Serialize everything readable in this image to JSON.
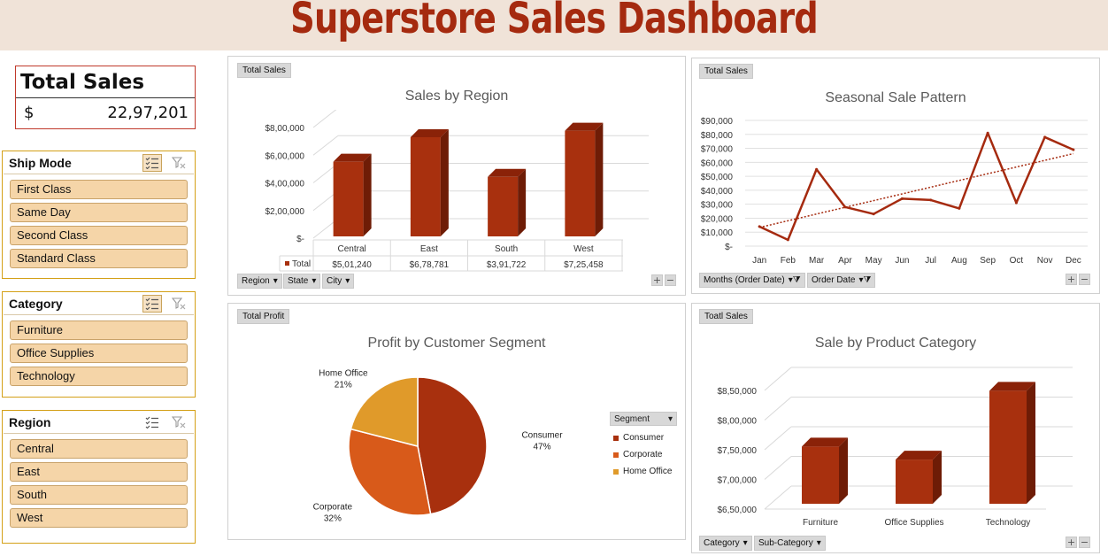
{
  "dashboard": {
    "title": "Superstore Sales Dashboard"
  },
  "kpi": {
    "title": "Total Sales",
    "currency": "$",
    "value": "22,97,201"
  },
  "slicers": {
    "ship_mode": {
      "label": "Ship Mode",
      "items": [
        "First Class",
        "Same Day",
        "Second Class",
        "Standard Class"
      ]
    },
    "category": {
      "label": "Category",
      "items": [
        "Furniture",
        "Office Supplies",
        "Technology"
      ]
    },
    "region": {
      "label": "Region",
      "items": [
        "Central",
        "East",
        "South",
        "West"
      ]
    }
  },
  "panels": {
    "region": {
      "tag": "Total Sales",
      "title": "Sales by Region",
      "fields": [
        "Region",
        "State",
        "City"
      ],
      "row_label": "Total"
    },
    "seasonal": {
      "tag": "Total Sales",
      "title": "Seasonal Sale Pattern",
      "fields": [
        "Months (Order Date)",
        "Order Date"
      ]
    },
    "profit": {
      "tag": "Total Profit",
      "title": "Profit by Customer Segment",
      "legend_title": "Segment"
    },
    "category": {
      "tag": "Toatl Sales",
      "title": "Sale by Product Category",
      "fields": [
        "Category",
        "Sub-Category"
      ]
    },
    "plus": "+",
    "minus": "−"
  },
  "colors": {
    "accent": "#a52a0f",
    "bar": "#a8300e",
    "bar_side": "#6e1c06",
    "bar_top": "#8a2208",
    "consumer": "#a8300e",
    "corporate": "#d85a1a",
    "home_office": "#e09a2a"
  },
  "chart_data": [
    {
      "type": "bar",
      "title": "Sales by Region",
      "categories": [
        "Central",
        "East",
        "South",
        "West"
      ],
      "values": [
        501240,
        678781,
        391722,
        725458
      ],
      "value_labels": [
        "$5,01,240",
        "$6,78,781",
        "$3,91,722",
        "$7,25,458"
      ],
      "y_ticks": [
        "$-",
        "$2,00,000",
        "$4,00,000",
        "$6,00,000",
        "$8,00,000"
      ],
      "ylim": [
        0,
        800000
      ]
    },
    {
      "type": "line",
      "title": "Seasonal Sale Pattern",
      "categories": [
        "Jan",
        "Feb",
        "Mar",
        "Apr",
        "May",
        "Jun",
        "Jul",
        "Aug",
        "Sep",
        "Oct",
        "Nov",
        "Dec"
      ],
      "values": [
        14000,
        4500,
        55000,
        28000,
        23000,
        34000,
        33000,
        27000,
        81000,
        31000,
        78000,
        69000
      ],
      "trendline": true,
      "y_ticks": [
        "$-",
        "$10,000",
        "$20,000",
        "$30,000",
        "$40,000",
        "$50,000",
        "$60,000",
        "$70,000",
        "$80,000",
        "$90,000"
      ],
      "ylim": [
        0,
        90000
      ]
    },
    {
      "type": "pie",
      "title": "Profit by Customer Segment",
      "labels": [
        "Consumer",
        "Corporate",
        "Home Office"
      ],
      "values": [
        47,
        32,
        21
      ],
      "value_labels": [
        "47%",
        "32%",
        "21%"
      ]
    },
    {
      "type": "bar",
      "title": "Sale by Product Category",
      "categories": [
        "Furniture",
        "Office Supplies",
        "Technology"
      ],
      "values": [
        742000,
        720000,
        836000
      ],
      "y_ticks": [
        "$6,50,000",
        "$7,00,000",
        "$7,50,000",
        "$8,00,000",
        "$8,50,000"
      ],
      "ylim": [
        650000,
        850000
      ]
    }
  ]
}
